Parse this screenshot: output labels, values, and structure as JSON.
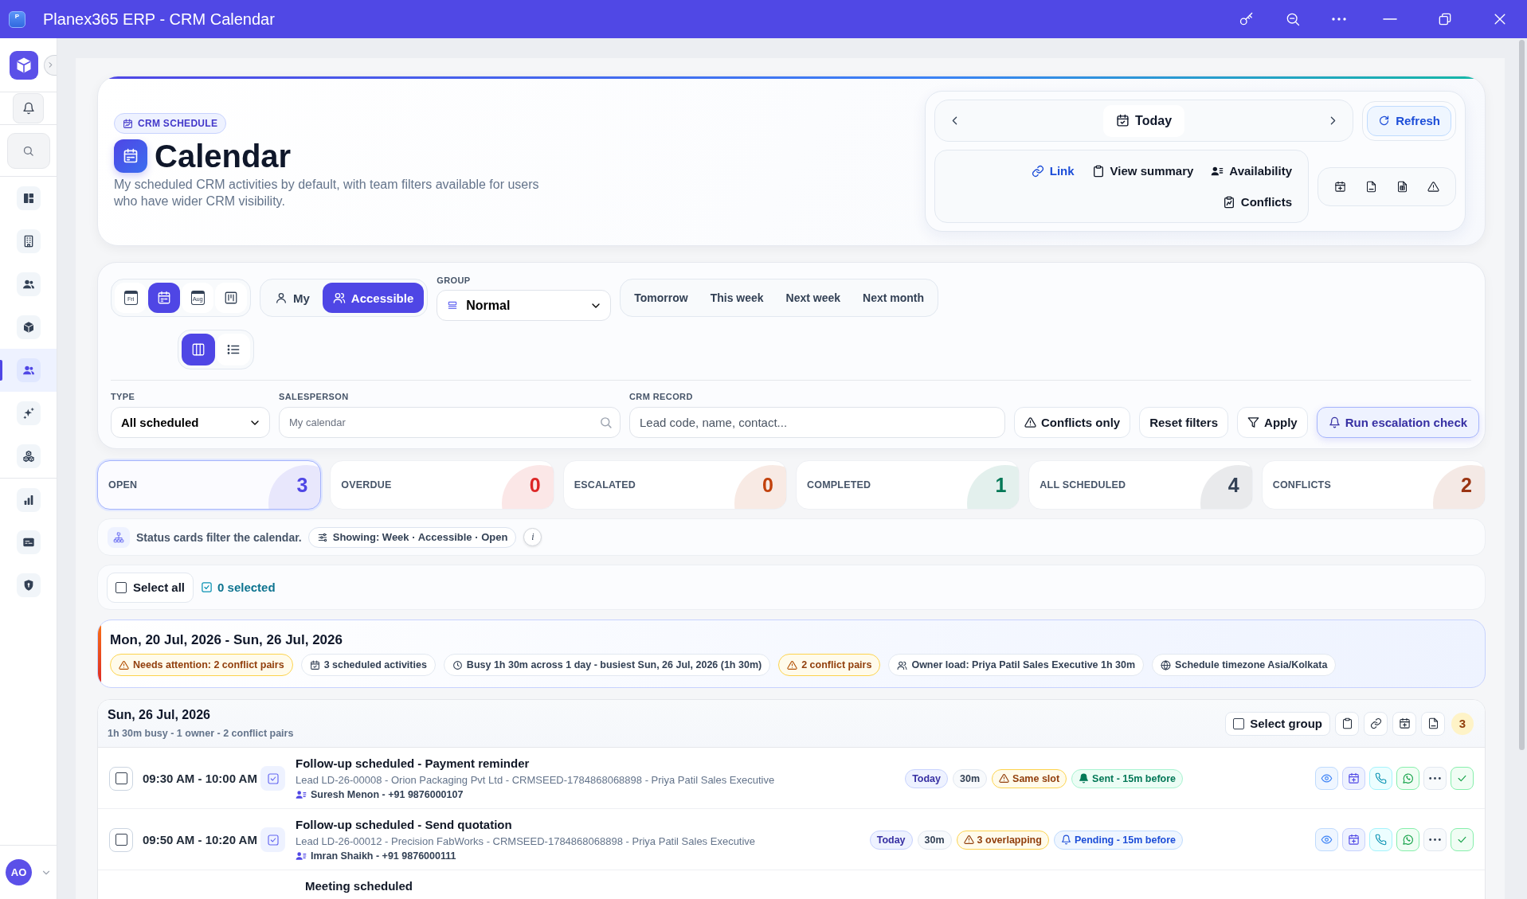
{
  "window": {
    "logo": "P",
    "title": "Planex365 ERP - CRM Calendar"
  },
  "sidebar": {
    "items": [
      {
        "selected": false
      },
      {
        "selected": false
      },
      {
        "selected": false
      },
      {
        "selected": false
      },
      {
        "selected": true
      },
      {
        "selected": false
      },
      {
        "selected": false
      },
      {
        "selected": false
      },
      {
        "selected": false
      },
      {
        "selected": false
      }
    ],
    "user": {
      "initials": "AO"
    }
  },
  "header": {
    "badge": "CRM SCHEDULE",
    "title": "Calendar",
    "description": "My scheduled CRM activities by default, with team filters available for users who have wider CRM visibility."
  },
  "date_nav": {
    "today": "Today",
    "refresh": "Refresh",
    "actions": [
      {
        "label": "Link",
        "kind": "link"
      },
      {
        "label": "View summary",
        "kind": "summary"
      },
      {
        "label": "Availability",
        "kind": "availability"
      },
      {
        "label": "Conflicts",
        "kind": "conflicts"
      }
    ]
  },
  "filters": {
    "view_modes": [
      {
        "kind": "day",
        "label": "Fri",
        "selected": false
      },
      {
        "kind": "week",
        "selected": true
      },
      {
        "kind": "month",
        "label": "Aug",
        "selected": false
      },
      {
        "kind": "board",
        "selected": false
      }
    ],
    "audience": [
      {
        "label": "My",
        "selected": false
      },
      {
        "label": "Accessible",
        "selected": true
      }
    ],
    "group": {
      "label": "GROUP",
      "value": "Normal"
    },
    "quick_ranges": [
      {
        "label": "Tomorrow",
        "selected": false
      },
      {
        "label": "This week",
        "selected": false
      },
      {
        "label": "Next week",
        "selected": false
      },
      {
        "label": "Next month",
        "selected": false
      }
    ],
    "layouts": [
      {
        "kind": "columns",
        "selected": true
      },
      {
        "kind": "list",
        "selected": false
      }
    ],
    "type": {
      "label": "TYPE",
      "value": "All scheduled"
    },
    "salesperson": {
      "label": "SALESPERSON",
      "placeholder": "My calendar"
    },
    "crm_record": {
      "label": "CRM RECORD",
      "placeholder": "Lead code, name, contact..."
    },
    "buttons": [
      {
        "label": "Conflicts only",
        "kind": "conflicts"
      },
      {
        "label": "Reset filters",
        "kind": "reset"
      },
      {
        "label": "Apply",
        "kind": "apply"
      },
      {
        "label": "Run escalation check",
        "kind": "escalation"
      }
    ]
  },
  "status_cards": [
    {
      "label": "OPEN",
      "count": "3",
      "color": "#4f46e5",
      "selected": true
    },
    {
      "label": "OVERDUE",
      "count": "0",
      "color": "#dc2626",
      "selected": false
    },
    {
      "label": "ESCALATED",
      "count": "0",
      "color": "#c2410c",
      "selected": false
    },
    {
      "label": "COMPLETED",
      "count": "1",
      "color": "#047857",
      "selected": false
    },
    {
      "label": "ALL SCHEDULED",
      "count": "4",
      "color": "#334155",
      "selected": false
    },
    {
      "label": "CONFLICTS",
      "count": "2",
      "color": "#9a3412",
      "selected": false
    }
  ],
  "hint_bar": {
    "text": "Status cards filter the calendar.",
    "showing": "Showing: Week · Accessible · Open",
    "info": "i"
  },
  "selection": {
    "select_all": "Select all",
    "checked": false,
    "count": "0 selected"
  },
  "week": {
    "title": "Mon, 20 Jul, 2026 - Sun, 26 Jul, 2026",
    "chips": [
      {
        "label": "Needs attention: 2 conflict pairs",
        "kind": "warning"
      },
      {
        "label": "3 scheduled activities",
        "kind": "activities"
      },
      {
        "label": "Busy 1h 30m across 1 day - busiest Sun, 26 Jul, 2026 (1h 30m)",
        "kind": "busy"
      },
      {
        "label": "2 conflict pairs",
        "kind": "warning"
      },
      {
        "label": "Owner load: Priya Patil Sales Executive 1h 30m",
        "kind": "owner"
      },
      {
        "label": "Schedule timezone Asia/Kolkata",
        "kind": "timezone"
      }
    ]
  },
  "day": {
    "date": "Sun, 26 Jul, 2026",
    "summary": "1h 30m busy - 1 owner - 2 conflict pairs",
    "select_group": "Select group",
    "select_group_checked": false,
    "count": "3",
    "activities": [
      {
        "checked": false,
        "time": "09:30 AM - 10:00 AM",
        "title": "Follow-up scheduled - Payment reminder",
        "details": "Lead LD-26-00008 - Orion Packaging Pvt Ltd - CRMSEED-1784868068898 - Priya Patil Sales Executive",
        "contact": "Suresh Menon - +91 9876000107",
        "tags": [
          {
            "label": "Today",
            "kind": "day"
          },
          {
            "label": "30m",
            "kind": "duration"
          },
          {
            "label": "Same slot",
            "kind": "conflict"
          },
          {
            "label": "Sent - 15m before",
            "kind": "reminder_sent"
          }
        ]
      },
      {
        "checked": false,
        "time": "09:50 AM - 10:20 AM",
        "title": "Follow-up scheduled - Send quotation",
        "details": "Lead LD-26-00012 - Precision FabWorks - CRMSEED-1784868068898 - Priya Patil Sales Executive",
        "contact": "Imran Shaikh - +91 9876000111",
        "tags": [
          {
            "label": "Today",
            "kind": "day"
          },
          {
            "label": "30m",
            "kind": "duration"
          },
          {
            "label": "3 overlapping",
            "kind": "conflict"
          },
          {
            "label": "Pending - 15m before",
            "kind": "reminder_pending"
          }
        ]
      },
      {
        "title": "Meeting scheduled"
      }
    ]
  }
}
